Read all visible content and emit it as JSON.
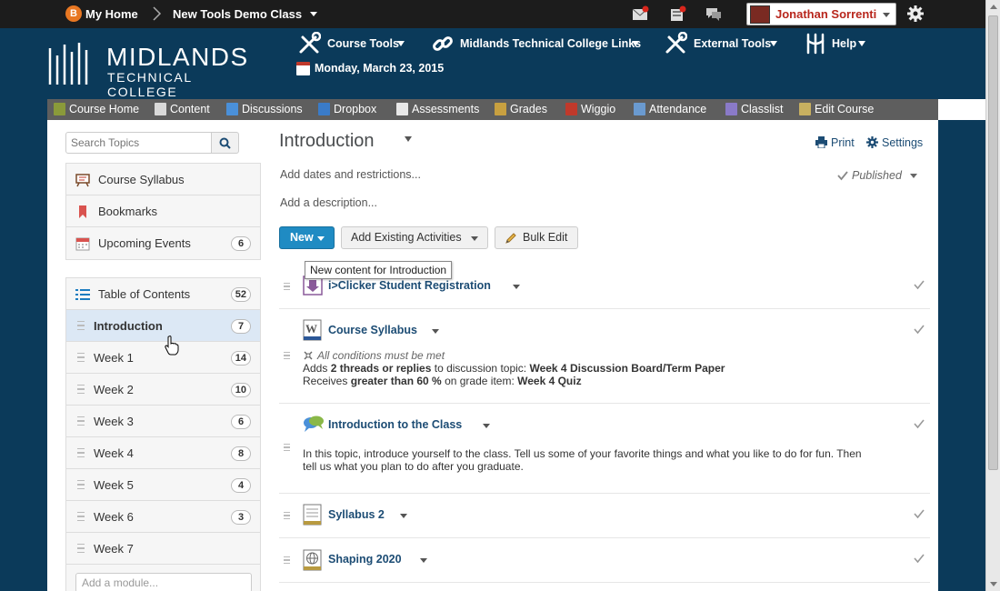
{
  "topbar": {
    "home_icon_letter": "B",
    "home_label": "My Home",
    "course_label": "New Tools Demo Class",
    "user_name": "Jonathan Sorrenti",
    "icons": [
      "mail-alert-icon",
      "subscription-alert-icon",
      "messages-icon",
      "gear-icon"
    ]
  },
  "header": {
    "logo_line1": "MIDLANDS",
    "logo_line2": "TECHNICAL COLLEGE",
    "nav": [
      {
        "label": "Course Tools",
        "icon": "tools-icon"
      },
      {
        "label": "Midlands Technical College Links",
        "icon": "links-icon"
      },
      {
        "label": "External Tools",
        "icon": "tools-icon"
      },
      {
        "label": "Help",
        "icon": "help-icon"
      }
    ],
    "date": "Monday, March 23, 2015"
  },
  "navbar": [
    {
      "label": "Course Home",
      "color": "#8a9a3a"
    },
    {
      "label": "Content",
      "color": "#d9d9d9"
    },
    {
      "label": "Discussions",
      "color": "#4a90d9"
    },
    {
      "label": "Dropbox",
      "color": "#3a7bc8"
    },
    {
      "label": "Assessments",
      "color": "#e8e8e8"
    },
    {
      "label": "Grades",
      "color": "#c8a040"
    },
    {
      "label": "Wiggio",
      "color": "#c0392b"
    },
    {
      "label": "Attendance",
      "color": "#6a9ad0"
    },
    {
      "label": "Classlist",
      "color": "#8a7ac8"
    },
    {
      "label": "Edit Course",
      "color": "#c8b060"
    }
  ],
  "sidebar": {
    "search_placeholder": "Search Topics",
    "tools": [
      {
        "label": "Course Syllabus",
        "badge": ""
      },
      {
        "label": "Bookmarks",
        "badge": ""
      },
      {
        "label": "Upcoming Events",
        "badge": "6"
      }
    ],
    "toc": {
      "label": "Table of Contents",
      "badge": "52"
    },
    "modules": [
      {
        "label": "Introduction",
        "badge": "7",
        "selected": true
      },
      {
        "label": "Week 1",
        "badge": "14"
      },
      {
        "label": "Week 2",
        "badge": "10"
      },
      {
        "label": "Week 3",
        "badge": "6"
      },
      {
        "label": "Week 4",
        "badge": "8"
      },
      {
        "label": "Week 5",
        "badge": "4"
      },
      {
        "label": "Week 6",
        "badge": "3"
      },
      {
        "label": "Week 7",
        "badge": ""
      }
    ],
    "add_module_placeholder": "Add a module..."
  },
  "main": {
    "title": "Introduction",
    "print_label": "Print",
    "settings_label": "Settings",
    "add_dates": "Add dates and restrictions...",
    "add_description": "Add a description...",
    "published_label": "Published",
    "new_button": "New",
    "add_existing_button": "Add Existing Activities",
    "bulk_edit_button": "Bulk Edit",
    "tooltip": "New content for Introduction",
    "items": [
      {
        "title": "i>Clicker Student Registration"
      },
      {
        "title": "Course Syllabus",
        "condition": "All conditions must be met",
        "line1_a": "Adds ",
        "line1_b": "2 threads or replies",
        "line1_c": " to discussion topic: ",
        "line1_d": "Week 4 Discussion Board/Term Paper",
        "line2_a": "Receives ",
        "line2_b": "greater than 60 %",
        "line2_c": " on grade item: ",
        "line2_d": "Week 4 Quiz"
      },
      {
        "title": "Introduction to the Class",
        "desc1": "In this topic, introduce yourself to the class.  Tell us some of your favorite things and what you like to do for fun.  Then",
        "desc2": "tell us what you plan to do after you graduate."
      },
      {
        "title": "Syllabus 2"
      },
      {
        "title": "Shaping 2020"
      }
    ]
  },
  "colors": {
    "header_bg": "#0b3a5a",
    "topbar_bg": "#1c1c1c",
    "accent_blue": "#1f8bc3",
    "link": "#1c4c74",
    "user_red": "#b8261c",
    "selected_bg": "#dce8f5"
  }
}
